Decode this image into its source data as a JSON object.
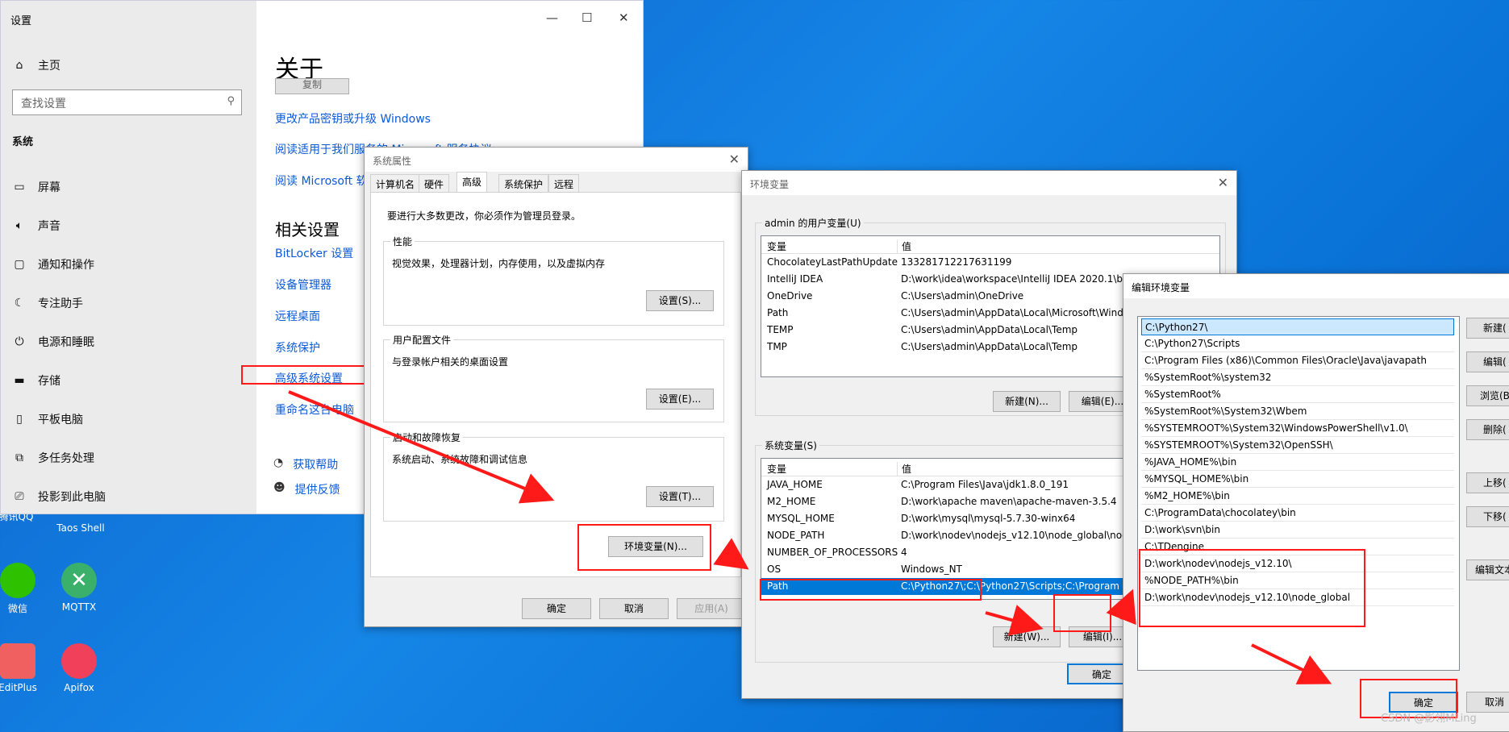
{
  "settings": {
    "title": "设置",
    "home": "主页",
    "search_placeholder": "查找设置",
    "section": "系统",
    "nav": [
      "屏幕",
      "声音",
      "通知和操作",
      "专注助手",
      "电源和睡眠",
      "存储",
      "平板电脑",
      "多任务处理",
      "投影到此电脑"
    ],
    "page_title": "关于",
    "copy_btn": "复制",
    "links_top": [
      "更改产品密钥或升级 Windows",
      "阅读适用于我们服务的 Microsoft 服务协议",
      "阅读 Microsoft 软件许可条款"
    ],
    "related_title": "相关设置",
    "related": [
      "BitLocker 设置",
      "设备管理器",
      "远程桌面",
      "系统保护",
      "高级系统设置",
      "重命名这台电脑"
    ],
    "help": "获取帮助",
    "feedback": "提供反馈"
  },
  "desktop": {
    "icons": [
      "腾讯QQ",
      "Taos Shell",
      "微信",
      "MQTTX",
      "EditPlus",
      "Apifox"
    ]
  },
  "sysprops": {
    "title": "系统属性",
    "tabs": [
      "计算机名",
      "硬件",
      "高级",
      "系统保护",
      "远程"
    ],
    "admin_note": "要进行大多数更改，你必须作为管理员登录。",
    "perf_label": "性能",
    "perf_desc": "视觉效果，处理器计划，内存使用，以及虚拟内存",
    "perf_btn": "设置(S)...",
    "profile_label": "用户配置文件",
    "profile_desc": "与登录帐户相关的桌面设置",
    "profile_btn": "设置(E)...",
    "startup_label": "启动和故障恢复",
    "startup_desc": "系统启动、系统故障和调试信息",
    "startup_btn": "设置(T)...",
    "env_btn": "环境变量(N)...",
    "ok": "确定",
    "cancel": "取消",
    "apply": "应用(A)"
  },
  "envvars": {
    "title": "环境变量",
    "user_label": "admin 的用户变量(U)",
    "col_var": "变量",
    "col_val": "值",
    "user_vars": [
      [
        "ChocolateyLastPathUpdate",
        "133281712217631199"
      ],
      [
        "IntelliJ IDEA",
        "D:\\work\\idea\\workspace\\IntelliJ IDEA 2020.1\\bi"
      ],
      [
        "OneDrive",
        "C:\\Users\\admin\\OneDrive"
      ],
      [
        "Path",
        "C:\\Users\\admin\\AppData\\Local\\Microsoft\\Wind"
      ],
      [
        "TEMP",
        "C:\\Users\\admin\\AppData\\Local\\Temp"
      ],
      [
        "TMP",
        "C:\\Users\\admin\\AppData\\Local\\Temp"
      ]
    ],
    "user_new": "新建(N)...",
    "user_edit": "编辑(E)...",
    "sys_label": "系统变量(S)",
    "sys_vars": [
      [
        "JAVA_HOME",
        "C:\\Program Files\\Java\\jdk1.8.0_191"
      ],
      [
        "M2_HOME",
        "D:\\work\\apache maven\\apache-maven-3.5.4"
      ],
      [
        "MYSQL_HOME",
        "D:\\work\\mysql\\mysql-5.7.30-winx64"
      ],
      [
        "NODE_PATH",
        "D:\\work\\nodev\\nodejs_v12.10\\node_global\\noc"
      ],
      [
        "NUMBER_OF_PROCESSORS",
        "4"
      ],
      [
        "OS",
        "Windows_NT"
      ],
      [
        "Path",
        "C:\\Python27\\;C:\\Python27\\Scripts;C:\\Program Fi"
      ]
    ],
    "sys_new": "新建(W)...",
    "sys_edit": "编辑(I)...",
    "ok": "确定"
  },
  "editenv": {
    "title": "编辑环境变量",
    "entries": [
      "C:\\Python27\\",
      "C:\\Python27\\Scripts",
      "C:\\Program Files (x86)\\Common Files\\Oracle\\Java\\javapath",
      "%SystemRoot%\\system32",
      "%SystemRoot%",
      "%SystemRoot%\\System32\\Wbem",
      "%SYSTEMROOT%\\System32\\WindowsPowerShell\\v1.0\\",
      "%SYSTEMROOT%\\System32\\OpenSSH\\",
      "%JAVA_HOME%\\bin",
      "%MYSQL_HOME%\\bin",
      "%M2_HOME%\\bin",
      "C:\\ProgramData\\chocolatey\\bin",
      "D:\\work\\svn\\bin",
      "C:\\TDengine",
      "D:\\work\\nodev\\nodejs_v12.10\\",
      "%NODE_PATH%\\bin",
      "D:\\work\\nodev\\nodejs_v12.10\\node_global"
    ],
    "buttons": [
      "新建(",
      "编辑(",
      "浏览(B",
      "删除(",
      "上移(",
      "下移(",
      "编辑文本"
    ],
    "ok": "确定",
    "cancel": "取消"
  },
  "watermark": "CSDN @影翎MLing",
  "colors": {
    "accent": "#0078d7",
    "annotation": "#ff1a1a",
    "link": "#0b5ad7"
  }
}
